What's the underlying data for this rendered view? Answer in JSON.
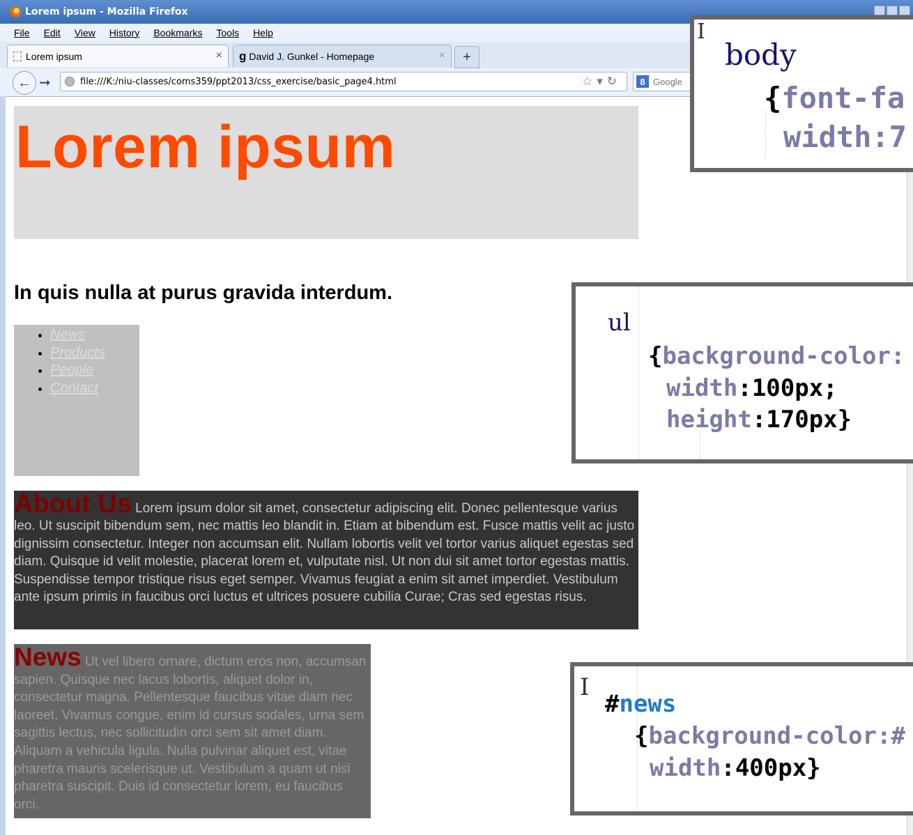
{
  "window": {
    "title": "Lorem ipsum - Mozilla Firefox"
  },
  "menu": [
    "File",
    "Edit",
    "View",
    "History",
    "Bookmarks",
    "Tools",
    "Help"
  ],
  "tabs": [
    {
      "label": "Lorem ipsum",
      "active": true
    },
    {
      "label": "David J. Gunkel - Homepage",
      "active": false
    }
  ],
  "new_tab_label": "+",
  "address_bar": {
    "url": "file:///K:/niu-classes/coms359/ppt2013/css_exercise/basic_page4.html"
  },
  "search_bar": {
    "placeholder": "Google"
  },
  "page": {
    "title": "Lorem ipsum",
    "subheading": "In quis nulla at purus gravida interdum.",
    "nav_items": [
      "News",
      "Products",
      "People",
      "Contact"
    ],
    "about": {
      "title": "About Us",
      "text": "Lorem ipsum dolor sit amet, consectetur adipiscing elit. Donec pellentesque varius leo. Ut suscipit bibendum sem, nec mattis leo blandit in. Etiam at bibendum est. Fusce mattis velit ac justo dignissim consectetur. Integer non accumsan elit. Nullam lobortis velit vel tortor varius aliquet egestas sed diam. Quisque id velit molestie, placerat lorem et, vulputate nisl. Ut non dui sit amet tortor egestas mattis. Suspendisse tempor tristique risus eget semper. Vivamus feugiat a enim sit amet imperdiet. Vestibulum ante ipsum primis in faucibus orci luctus et ultrices posuere cubilia Curae; Cras sed egestas risus."
    },
    "news": {
      "title": "News",
      "text": "Ut vel libero ornare, dictum eros non, accumsan sapien. Quisque nec lacus lobortis, aliquet dolor in, consectetur magna. Pellentesque faucibus vitae diam nec laoreet. Vivamus congue, enim id cursus sodales, urna sem sagittis lectus, nec sollicitudin orci sem sit amet diam. Aliquam a vehicula ligula. Nulla pulvinar aliquet est, vitae pharetra mauris scelerisque ut. Vestibulum a quam ut nisi pharetra suscipit. Duis id consectetur lorem, eu faucibus orci."
    }
  },
  "code_callouts": {
    "body": {
      "selector": "body",
      "line1": "{font-fa",
      "line2": "width:7"
    },
    "ul": {
      "selector": "ul",
      "line1": "{background-color:",
      "prop2": "width",
      "val2": ":100px;",
      "prop3": "height",
      "val3": ":170px}"
    },
    "news": {
      "hash": "#",
      "selector": "news",
      "line1": "{background-color:#",
      "prop2": "width",
      "val2": ":400px}"
    }
  },
  "colors": {
    "heading_orange": "#ff4a00",
    "about_bg": "#333333",
    "news_bg": "#666666",
    "nav_bg": "#c0c0c0",
    "header_bg": "#dddddd"
  }
}
